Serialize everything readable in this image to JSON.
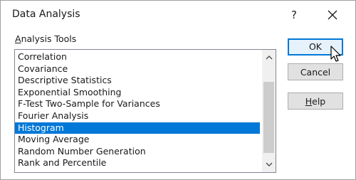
{
  "window": {
    "title": "Data Analysis",
    "help_glyph": "?"
  },
  "group": {
    "label_prefix": "",
    "label_accel": "A",
    "label_rest": "nalysis Tools"
  },
  "list": {
    "items": [
      "Correlation",
      "Covariance",
      "Descriptive Statistics",
      "Exponential Smoothing",
      "F-Test Two-Sample for Variances",
      "Fourier Analysis",
      "Histogram",
      "Moving Average",
      "Random Number Generation",
      "Rank and Percentile"
    ],
    "selected": "Histogram"
  },
  "buttons": {
    "ok": "OK",
    "cancel": "Cancel",
    "help_accel": "H",
    "help_rest": "elp"
  },
  "colors": {
    "selection": "#0078d7",
    "default_button_border": "#0078d7"
  },
  "icons": {
    "close": "close-icon",
    "scroll_up": "chevron-up-icon",
    "scroll_down": "chevron-down-icon",
    "cursor": "mouse-pointer-icon"
  }
}
